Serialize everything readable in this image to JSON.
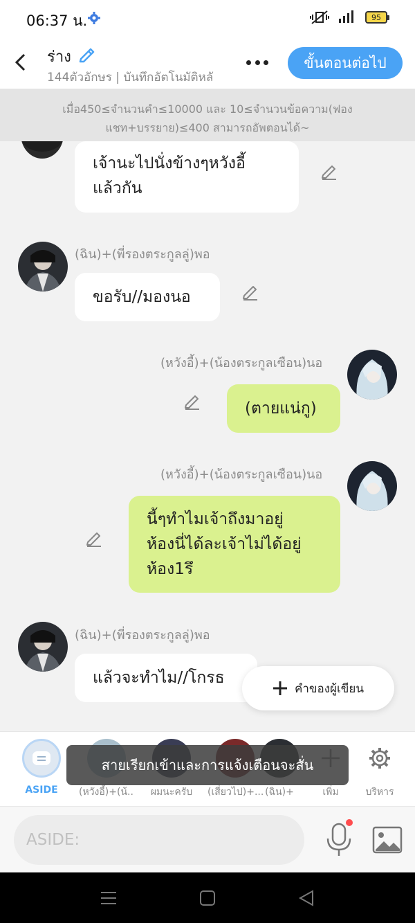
{
  "status": {
    "time": "06:37 น.",
    "battery": "95"
  },
  "header": {
    "title": "ร่าง",
    "subtitle": "144ตัวอักษร | บันทึกอัตโนมัติหลั",
    "next_label": "ขั้นตอนต่อไป"
  },
  "notice": "เมื่อ450≤จำนวนคำ≤10000 และ 10≤จำนวนข้อความ(ฟองแชท+บรรยาย)≤400 สามารถอัพตอนได้~",
  "messages": [
    {
      "text": "เจ้านะไปนั่งข้างๆหวังอี้\nแล้วกัน"
    },
    {
      "name": "(ฉิน)+(พี่รองตระกูลลู่)พอ",
      "text": "ขอรับ//มองนอ"
    },
    {
      "name": "(หวังอี้)+(น้องตระกูลเซือน)นอ",
      "text": "(ตายแน่กู)"
    },
    {
      "name": "(หวังอี้)+(น้องตระกูลเซือน)นอ",
      "text": "นี้ๆทำไมเจ้าถึงมาอยู่\nห้องนี่ได้ละเจ้าไม่ได้อยู่\nห้อง1รึ"
    },
    {
      "name": "(ฉิน)+(พี่รองตระกูลลู่)พอ",
      "text": "แล้วจะทำไม//โกรธ"
    }
  ],
  "fab_label": "คำของผู้เขียน",
  "characters": [
    {
      "label": "ASIDE"
    },
    {
      "label": "(หวังอี้)+(น้..."
    },
    {
      "label": "ผมนะครับ"
    },
    {
      "label": "(เสี่ยวไป)+..."
    },
    {
      "label": "(ฉิน)+"
    },
    {
      "label": "เพิ่ม"
    },
    {
      "label": "บริหาร"
    }
  ],
  "toast": "สายเรียกเข้าและการแจ้งเตือนจะสั่น",
  "input": {
    "placeholder": "ASIDE:"
  },
  "colors": {
    "accent": "#4aa3f5",
    "green_bubble": "#daf18f"
  }
}
